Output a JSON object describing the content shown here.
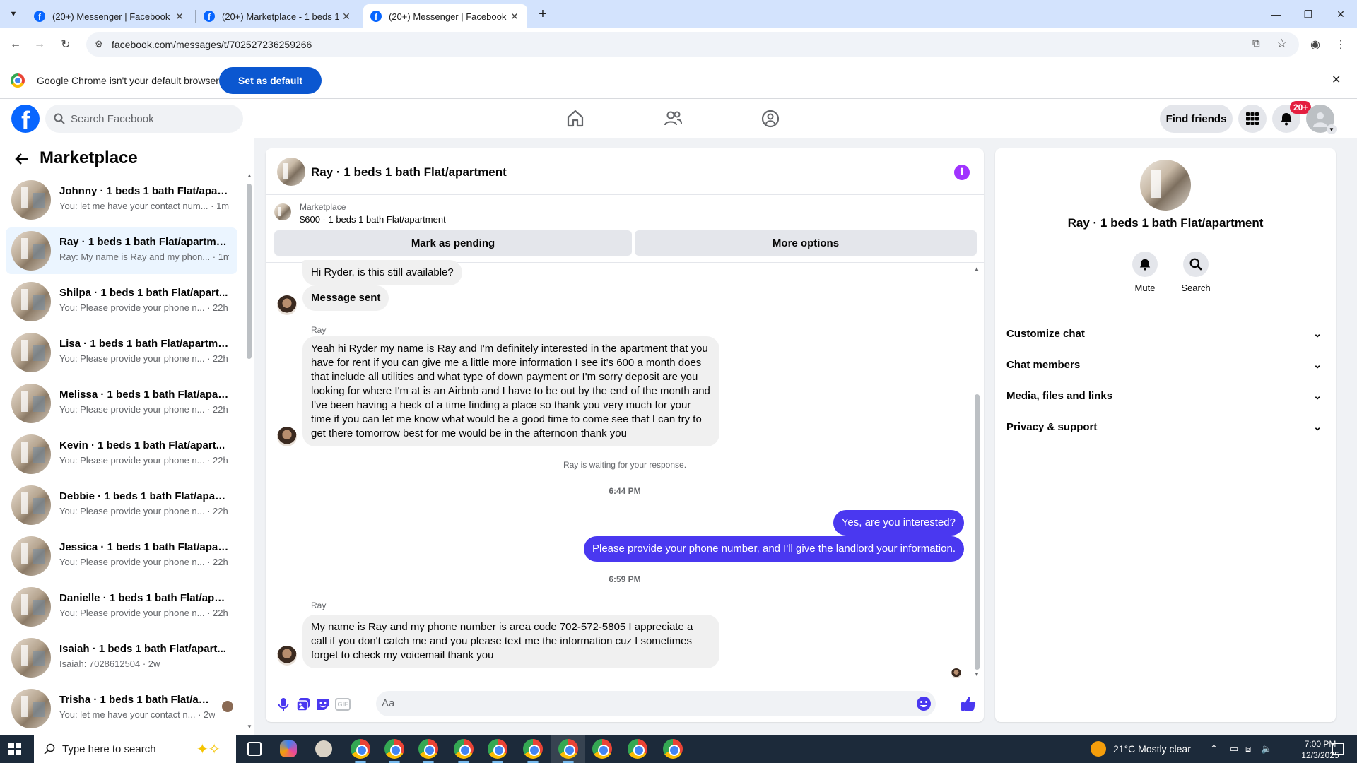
{
  "browser": {
    "tabs": [
      {
        "title": "(20+) Messenger | Facebook",
        "active": false
      },
      {
        "title": "(20+) Marketplace - 1 beds 1 b",
        "active": false
      },
      {
        "title": "(20+) Messenger | Facebook",
        "active": true
      }
    ],
    "url": "facebook.com/messages/t/702527236259266",
    "banner_text": "Google Chrome isn't your default browser",
    "banner_button": "Set as default"
  },
  "fb": {
    "search_placeholder": "Search Facebook",
    "find_friends": "Find friends",
    "notif_badge": "20+"
  },
  "sidebar": {
    "title": "Marketplace",
    "conversations": [
      {
        "name": "Johnny · 1 beds 1 bath Flat/apart...",
        "preview": "You: let me have your contact num... · 1m",
        "selected": false
      },
      {
        "name": "Ray · 1 beds 1 bath Flat/apartment",
        "preview": "Ray: My name is Ray and my phon... · 1m",
        "selected": true
      },
      {
        "name": "Shilpa · 1 beds 1 bath Flat/apart...",
        "preview": "You: Please provide your phone n... · 22h",
        "selected": false
      },
      {
        "name": "Lisa · 1 beds 1 bath Flat/apartment",
        "preview": "You: Please provide your phone n... · 22h",
        "selected": false
      },
      {
        "name": "Melissa · 1 beds 1 bath Flat/apar...",
        "preview": "You: Please provide your phone n... · 22h",
        "selected": false
      },
      {
        "name": "Kevin · 1 beds 1 bath Flat/apart...",
        "preview": "You: Please provide your phone n... · 22h",
        "selected": false
      },
      {
        "name": "Debbie · 1 beds 1 bath Flat/apart...",
        "preview": "You: Please provide your phone n... · 22h",
        "selected": false
      },
      {
        "name": "Jessica · 1 beds 1 bath Flat/apart...",
        "preview": "You: Please provide your phone n... · 22h",
        "selected": false
      },
      {
        "name": "Danielle · 1 beds 1 bath Flat/apar...",
        "preview": "You: Please provide your phone n... · 22h",
        "selected": false
      },
      {
        "name": "Isaiah · 1 beds 1 bath Flat/apart...",
        "preview": "Isaiah: 7028612504 · 2w",
        "selected": false
      },
      {
        "name": "Trisha · 1 beds 1 bath Flat/apar...",
        "preview": "You: let me have your contact n... · 2w",
        "selected": false
      }
    ]
  },
  "chat": {
    "title": "Ray · 1 beds 1 bath Flat/apartment",
    "marketplace_label": "Marketplace",
    "listing": "$600 - 1 beds 1 bath Flat/apartment",
    "mark_pending": "Mark as pending",
    "more_options": "More options",
    "messages": {
      "m1": "Hi Ryder, is this still available?",
      "m2": "Message sent",
      "sender1": "Ray",
      "m3": "Yeah hi Ryder my name is Ray and I'm definitely interested in the apartment that you have for rent if you can give me a little more information I see it's 600 a month does that include all utilities and what type of down payment or I'm sorry deposit are you looking for where I'm at is an Airbnb and I have to be out by the end of the month and I've been having a heck of a time finding a place so thank you very much for your time if you can let me know what would be a good time to come see that I can try to get there tomorrow best for me would be in the afternoon thank you",
      "waiting": "Ray is waiting for your response.",
      "time1": "6:44 PM",
      "m4": "Yes, are you interested?",
      "m5": "Please provide your phone number, and I'll give the landlord your information.",
      "time2": "6:59 PM",
      "sender2": "Ray",
      "m6": "My name is Ray and my phone number is area code 702-572-5805 I appreciate a call if you don't catch me and you please text me the information cuz I sometimes forget to check my voicemail thank you"
    },
    "input_placeholder": "Aa"
  },
  "details": {
    "name": "Ray · 1 beds 1 bath Flat/apartment",
    "mute": "Mute",
    "search": "Search",
    "sections": [
      "Customize chat",
      "Chat members",
      "Media, files and links",
      "Privacy & support"
    ]
  },
  "taskbar": {
    "search_placeholder": "Type here to search",
    "weather": "21°C  Mostly clear",
    "time": "7:00 PM",
    "date": "12/3/2025"
  },
  "colors": {
    "fb_blue": "#0866ff",
    "outgoing_bubble": "#4a38f0",
    "info_purple": "#a033ff",
    "chrome_accent": "#0b57d0"
  }
}
